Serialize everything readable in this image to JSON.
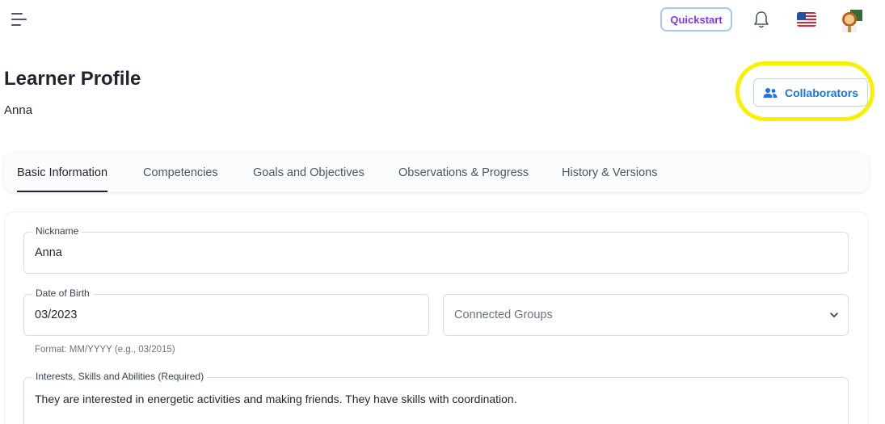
{
  "topbar": {
    "quickstart_label": "Quickstart",
    "icons": [
      "menu-icon",
      "bell-icon",
      "us-flag-icon",
      "avatar-icon"
    ]
  },
  "header": {
    "title": "Learner Profile",
    "learner_name": "Anna",
    "collaborators_label": "Collaborators"
  },
  "tabs": [
    {
      "label": "Basic Information",
      "active": true
    },
    {
      "label": "Competencies",
      "active": false
    },
    {
      "label": "Goals and Objectives",
      "active": false
    },
    {
      "label": "Observations & Progress",
      "active": false
    },
    {
      "label": "History & Versions",
      "active": false
    }
  ],
  "form": {
    "nickname": {
      "label": "Nickname",
      "value": "Anna"
    },
    "dob": {
      "label": "Date of Birth",
      "value": "03/2023",
      "helper": "Format: MM/YYYY (e.g., 03/2015)"
    },
    "groups": {
      "placeholder": "Connected Groups"
    },
    "interests": {
      "label": "Interests, Skills and Abilities (Required)",
      "value": "They are interested in energetic activities and making friends. They have skills with coordination."
    }
  },
  "colors": {
    "accent": "#1a73e8",
    "quickstart_text": "#7c3aed",
    "highlight": "#f7f000"
  }
}
